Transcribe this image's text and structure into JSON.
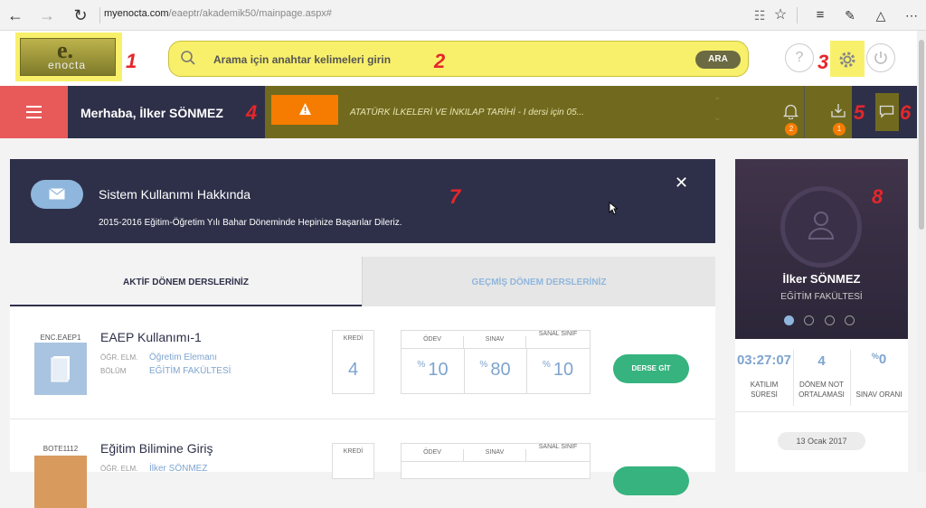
{
  "browser": {
    "url_domain": "myenocta.com",
    "url_path": "/eaeptr/akademik50/mainpage.aspx#"
  },
  "logo": {
    "mark": "e.",
    "text": "enocta"
  },
  "annotations": [
    "1",
    "2",
    "3",
    "4",
    "5",
    "6",
    "7",
    "8"
  ],
  "search": {
    "placeholder": "Arama için anahtar kelimeleri girin",
    "button": "ARA"
  },
  "header": {
    "help": "?"
  },
  "navbar": {
    "greeting": "Merhaba, İlker SÖNMEZ",
    "alert_text": "ATATÜRK İLKELERİ VE İNKILAP TARİHİ - I dersi için 05...",
    "notifications_count": "2",
    "downloads_count": "1"
  },
  "notice": {
    "title": "Sistem Kullanımı Hakkında",
    "body": "2015-2016 Eğitim-Öğretim Yılı Bahar Döneminde Hepinize Başarılar Dileriz.",
    "close": "✕"
  },
  "tabs": {
    "active": "AKTİF DÖNEM DERSLERİNİZ",
    "past": "GEÇMİŞ DÖNEM DERSLERİNİZ"
  },
  "course_labels": {
    "teacher": "ÖĞR. ELM.",
    "dept": "BÖLÜM",
    "credit": "KREDİ",
    "homework": "ÖDEV",
    "exam": "SINAV",
    "virtual": "SANAL SINIF",
    "pct": "%",
    "go": "DERSE GİT"
  },
  "courses": [
    {
      "code": "ENC.EAEP1",
      "name": "EAEP Kullanımı-1",
      "teacher": "Öğretim Elemanı",
      "dept": "EĞİTİM FAKÜLTESİ",
      "credit": "4",
      "homework": "10",
      "exam": "80",
      "virtual": "10"
    },
    {
      "code": "BOTE1112",
      "name": "Eğitim Bilimine Giriş",
      "teacher": "İlker SÖNMEZ"
    }
  ],
  "profile": {
    "name": "İlker SÖNMEZ",
    "faculty": "EĞİTİM FAKÜLTESİ"
  },
  "stats": {
    "time": "03:27:07",
    "time_label_1": "KATILIM",
    "time_label_2": "SÜRESİ",
    "gpa": "4",
    "gpa_label_1": "DÖNEM NOT",
    "gpa_label_2": "ORTALAMASI",
    "exam_pct_sign": "%",
    "exam_pct": "0",
    "exam_label": "SINAV ORANI"
  },
  "date": "13 Ocak 2017"
}
